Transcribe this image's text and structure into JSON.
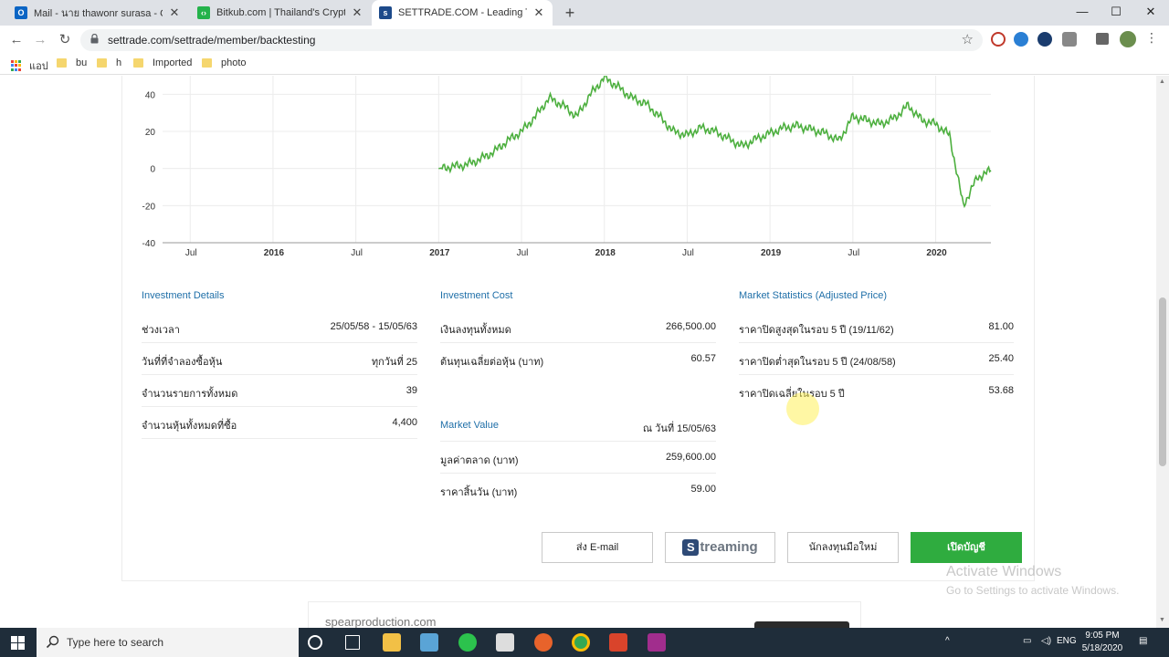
{
  "browser": {
    "tabs": [
      {
        "title": "Mail - นาย thawonr surasa - Outlook",
        "favicon": "outlook-icon",
        "color": "#0a64c4",
        "active": false
      },
      {
        "title": "Bitkub.com | Thailand's Cryptocurrency",
        "favicon": "bitkub-icon",
        "color": "#24b24b",
        "active": false
      },
      {
        "title": "SETTRADE.COM - Leading Technology",
        "favicon": "settrade-icon",
        "color": "#1d4a8a",
        "active": true
      }
    ],
    "url": "settrade.com/settrade/member/backtesting",
    "bookmarks": [
      {
        "label": "แอป",
        "type": "apps"
      },
      {
        "label": "bu",
        "type": "folder"
      },
      {
        "label": "h",
        "type": "folder"
      },
      {
        "label": "Imported",
        "type": "folder"
      },
      {
        "label": "photo",
        "type": "folder"
      }
    ]
  },
  "chart_data": {
    "type": "line",
    "series": [
      {
        "color": "#4caf3e",
        "x": [
          "2017-01",
          "2017-02",
          "2017-03",
          "2017-04",
          "2017-05",
          "2017-06",
          "2017-07",
          "2017-08",
          "2017-09",
          "2017-10",
          "2017-11",
          "2017-12",
          "2018-01",
          "2018-02",
          "2018-03",
          "2018-04",
          "2018-05",
          "2018-06",
          "2018-07",
          "2018-08",
          "2018-09",
          "2018-10",
          "2018-11",
          "2018-12",
          "2019-01",
          "2019-02",
          "2019-03",
          "2019-04",
          "2019-05",
          "2019-06",
          "2019-07",
          "2019-08",
          "2019-09",
          "2019-10",
          "2019-11",
          "2019-12",
          "2020-01",
          "2020-02",
          "2020-03",
          "2020-04",
          "2020-05"
        ],
        "y": [
          0,
          1,
          2,
          5,
          9,
          15,
          20,
          28,
          38,
          34,
          28,
          40,
          49,
          44,
          38,
          35,
          28,
          20,
          18,
          22,
          20,
          16,
          12,
          16,
          19,
          22,
          23,
          21,
          19,
          15,
          28,
          26,
          24,
          27,
          34,
          26,
          24,
          18,
          -20,
          -5,
          -1
        ]
      }
    ],
    "x_ticks": [
      "Jul",
      "2016",
      "Jul",
      "2017",
      "Jul",
      "2018",
      "Jul",
      "2019",
      "Jul",
      "2020"
    ],
    "x_tick_dates": [
      "2015-07",
      "2016-01",
      "2016-07",
      "2017-01",
      "2017-07",
      "2018-01",
      "2018-07",
      "2019-01",
      "2019-07",
      "2020-01"
    ],
    "x_range": [
      "2015-05",
      "2020-05"
    ],
    "y_ticks": [
      40,
      20,
      0,
      -20,
      -40
    ],
    "ylim": [
      -40,
      50
    ],
    "grid": true,
    "title": "",
    "xlabel": "",
    "ylabel": ""
  },
  "investment_details": {
    "title": "Investment Details",
    "rows": [
      {
        "label": "ช่วงเวลา",
        "value": "25/05/58 - 15/05/63"
      },
      {
        "label": "วันที่ที่จำลองซื้อหุ้น",
        "value": "ทุกวันที่ 25"
      },
      {
        "label": "จำนวนรายการทั้งหมด",
        "value": "39"
      },
      {
        "label": "จำนวนหุ้นทั้งหมดที่ซื้อ",
        "value": "4,400"
      }
    ]
  },
  "investment_cost": {
    "title": "Investment Cost",
    "rows": [
      {
        "label": "เงินลงทุนทั้งหมด",
        "value": "266,500.00"
      },
      {
        "label": "ต้นทุนเฉลี่ยต่อหุ้น (บาท)",
        "value": "60.57"
      }
    ]
  },
  "market_value": {
    "title": "Market Value",
    "as_of": "ณ วันที่ 15/05/63",
    "rows": [
      {
        "label": "มูลค่าตลาด (บาท)",
        "value": "259,600.00"
      },
      {
        "label": "ราคาสิ้นวัน (บาท)",
        "value": "59.00"
      }
    ]
  },
  "market_statistics": {
    "title": "Market Statistics (Adjusted Price)",
    "rows": [
      {
        "label": "ราคาปิดสูงสุดในรอบ 5 ปี (19/11/62)",
        "value": "81.00"
      },
      {
        "label": "ราคาปิดต่ำสุดในรอบ 5 ปี (24/08/58)",
        "value": "25.40"
      },
      {
        "label": "ราคาปิดเฉลี่ยในรอบ 5 ปี",
        "value": "53.68"
      }
    ]
  },
  "buttons": {
    "email": "ส่ง E-mail",
    "streaming_text": "treaming",
    "streaming_s": "S",
    "new_investor": "นักลงทุนมือใหม่",
    "open_account": "เปิดบัญชี"
  },
  "watermark": {
    "line1": "Activate Windows",
    "line2": "Go to Settings to activate Windows."
  },
  "footer": {
    "text": "spearproduction.com"
  },
  "taskbar": {
    "search_placeholder": "Type here to search",
    "time": "9:05 PM",
    "date": "5/18/2020",
    "lang": "ENG"
  },
  "colors": {
    "accent": "#2fac3f",
    "link": "#1f6fa8",
    "line": "#4caf3e"
  }
}
